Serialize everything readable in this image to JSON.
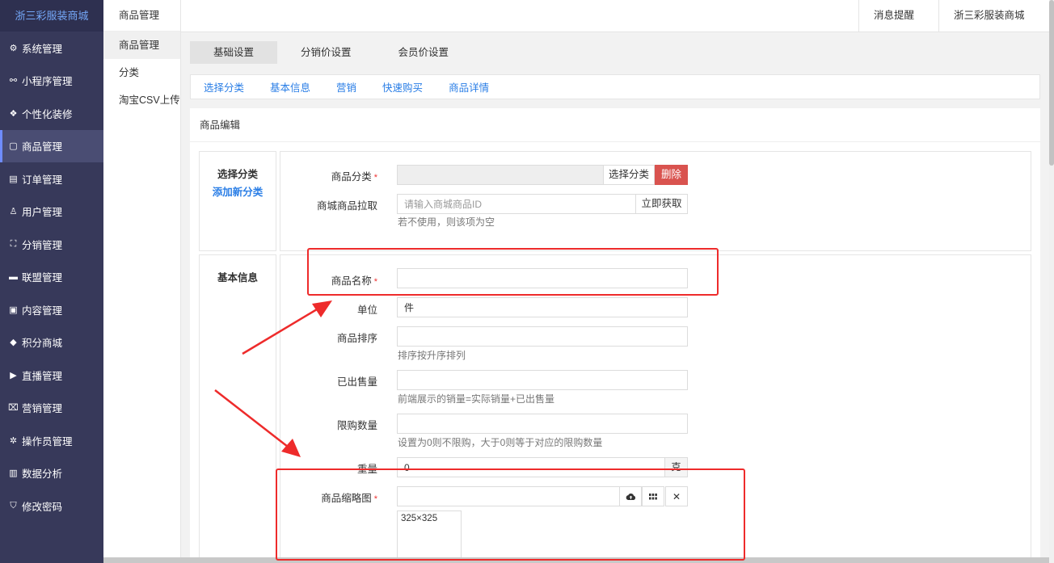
{
  "brand": "浙三彩服装商城",
  "sidebar": {
    "items": [
      {
        "label": "系统管理",
        "icon": "gear-icon"
      },
      {
        "label": "小程序管理",
        "icon": "link-icon"
      },
      {
        "label": "个性化装修",
        "icon": "decoration-icon"
      },
      {
        "label": "商品管理",
        "icon": "product-icon",
        "active": true
      },
      {
        "label": "订单管理",
        "icon": "order-icon"
      },
      {
        "label": "用户管理",
        "icon": "user-icon"
      },
      {
        "label": "分销管理",
        "icon": "sitemap-icon"
      },
      {
        "label": "联盟管理",
        "icon": "alliance-icon"
      },
      {
        "label": "内容管理",
        "icon": "content-icon"
      },
      {
        "label": "积分商城",
        "icon": "cube-icon"
      },
      {
        "label": "直播管理",
        "icon": "play-icon"
      },
      {
        "label": "营销管理",
        "icon": "marketing-icon"
      },
      {
        "label": "操作员管理",
        "icon": "cog-icon"
      },
      {
        "label": "数据分析",
        "icon": "chart-icon"
      },
      {
        "label": "修改密码",
        "icon": "shield-icon"
      }
    ]
  },
  "subnav": {
    "title": "商品管理",
    "items": [
      "商品管理",
      "分类",
      "淘宝CSV上传"
    ]
  },
  "topbar": {
    "notify": "消息提醒",
    "store": "浙三彩服装商城"
  },
  "tabs": [
    "基础设置",
    "分销价设置",
    "会员价设置"
  ],
  "anchors": [
    "选择分类",
    "基本信息",
    "营销",
    "快速购买",
    "商品详情"
  ],
  "panel": {
    "title": "商品编辑"
  },
  "category_section": {
    "title": "选择分类",
    "add_link": "添加新分类",
    "category_label": "商品分类",
    "select_button": "选择分类",
    "delete_button": "删除",
    "pull_label": "商城商品拉取",
    "pull_placeholder": "请输入商城商品ID",
    "pull_button": "立即获取",
    "pull_help": "若不使用，则该项为空"
  },
  "basic_section": {
    "title": "基本信息",
    "name_label": "商品名称",
    "unit_label": "单位",
    "unit_value": "件",
    "sort_label": "商品排序",
    "sort_help": "排序按升序排列",
    "sold_label": "已出售量",
    "sold_help": "前端展示的销量=实际销量+已出售量",
    "limit_label": "限购数量",
    "limit_help": "设置为0则不限购，大于0则等于对应的限购数量",
    "weight_label": "重量",
    "weight_value": "0",
    "weight_unit": "克",
    "thumb_label": "商品缩略图",
    "thumb_size": "325×325"
  },
  "required_mark": "*",
  "colors": {
    "sidebar_bg": "#37395a",
    "accent_blue": "#2a7ee6",
    "danger": "#d9534f",
    "annotation_red": "#ee2b2b"
  }
}
